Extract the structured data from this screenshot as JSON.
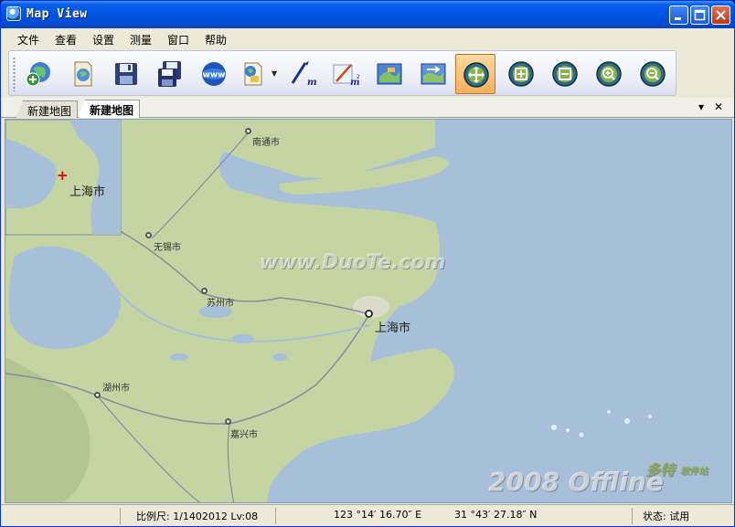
{
  "window": {
    "title": "Map View"
  },
  "menu": [
    "文件",
    "查看",
    "设置",
    "测量",
    "窗口",
    "帮助"
  ],
  "toolbar": {
    "buttons": [
      {
        "name": "add-layer-icon"
      },
      {
        "name": "layer-manager-icon"
      },
      {
        "name": "save-icon"
      },
      {
        "name": "save-as-icon"
      },
      {
        "name": "web-map-icon"
      },
      {
        "name": "map-source-icon",
        "dropdown": true
      },
      {
        "name": "measure-distance-icon"
      },
      {
        "name": "measure-area-icon"
      },
      {
        "name": "map-view-icon"
      },
      {
        "name": "map-refresh-icon"
      },
      {
        "name": "pan-icon",
        "active": true
      },
      {
        "name": "zoom-full-icon"
      },
      {
        "name": "zoom-window-icon"
      },
      {
        "name": "zoom-in-icon"
      },
      {
        "name": "zoom-out-icon"
      }
    ]
  },
  "tabs": [
    {
      "label": "新建地图",
      "active": false
    },
    {
      "label": "新建地图",
      "active": true
    }
  ],
  "tab_controls": {
    "dropdown": "▾",
    "close": "✕"
  },
  "map": {
    "overview_label": "上海市",
    "cities": [
      {
        "label": "南通市"
      },
      {
        "label": "无锡市"
      },
      {
        "label": "苏州市"
      },
      {
        "label": "上海市"
      },
      {
        "label": "湖州市"
      },
      {
        "label": "嘉兴市"
      }
    ],
    "watermark": "www.DuoTe.com",
    "watermark2": "2008 Offline",
    "watermark3": "多特",
    "watermark4": "软件站",
    "colors": {
      "land": "#c4d4a3",
      "water": "#a8bfd9",
      "road": "#8a8aa0"
    }
  },
  "statusbar": {
    "scale": "比例尺: 1/1402012 Lv:08",
    "longitude": "123 °14′ 16.70″  E",
    "latitude": "31 °43′ 27.18″  N",
    "state": "状态:  试用"
  }
}
